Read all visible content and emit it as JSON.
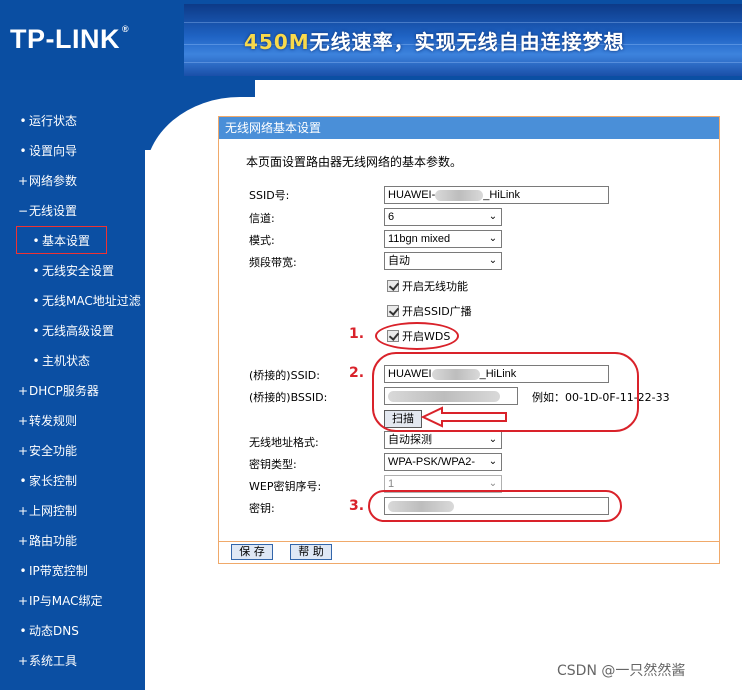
{
  "header": {
    "logo": "TP-LINK",
    "logo_mark": "®",
    "slogan_highlight": "450M",
    "slogan_rest": "无线速率，实现无线自由连接梦想"
  },
  "sidebar": {
    "items": [
      {
        "bullet": "•",
        "label": "运行状态"
      },
      {
        "bullet": "•",
        "label": "设置向导"
      },
      {
        "bullet": "+",
        "label": "网络参数"
      },
      {
        "bullet": "−",
        "label": "无线设置"
      },
      {
        "bullet": "•",
        "label": "基本设置",
        "active": true
      },
      {
        "bullet": "•",
        "label": "无线安全设置"
      },
      {
        "bullet": "•",
        "label": "无线MAC地址过滤"
      },
      {
        "bullet": "•",
        "label": "无线高级设置"
      },
      {
        "bullet": "•",
        "label": "主机状态"
      },
      {
        "bullet": "+",
        "label": "DHCP服务器"
      },
      {
        "bullet": "+",
        "label": "转发规则"
      },
      {
        "bullet": "+",
        "label": "安全功能"
      },
      {
        "bullet": "•",
        "label": "家长控制"
      },
      {
        "bullet": "+",
        "label": "上网控制"
      },
      {
        "bullet": "+",
        "label": "路由功能"
      },
      {
        "bullet": "•",
        "label": "IP带宽控制"
      },
      {
        "bullet": "+",
        "label": "IP与MAC绑定"
      },
      {
        "bullet": "•",
        "label": "动态DNS"
      },
      {
        "bullet": "+",
        "label": "系统工具"
      }
    ]
  },
  "panel": {
    "title": "无线网络基本设置",
    "description": "本页面设置路由器无线网络的基本参数。",
    "ssid_label": "SSID号:",
    "ssid_prefix": "HUAWEI-",
    "ssid_suffix": "_HiLink",
    "channel_label": "信道:",
    "channel_value": "6",
    "mode_label": "模式:",
    "mode_value": "11bgn mixed",
    "bandwidth_label": "频段带宽:",
    "bandwidth_value": "自动",
    "enable_wireless": "开启无线功能",
    "enable_ssid_broadcast": "开启SSID广播",
    "enable_wds": "开启WDS",
    "bridge_ssid_label": "(桥接的)SSID:",
    "bridge_ssid_prefix": "HUAWEI",
    "bridge_ssid_suffix": "_HiLink",
    "bridge_bssid_label": "(桥接的)BSSID:",
    "bssid_example": "例如：00-1D-0F-11-22-33",
    "scan_button": "扫描",
    "address_format_label": "无线地址格式:",
    "address_format_value": "自动探测",
    "key_type_label": "密钥类型:",
    "key_type_value": "WPA-PSK/WPA2-",
    "wep_index_label": "WEP密钥序号:",
    "wep_index_value": "1",
    "key_label": "密钥:",
    "save_button": "保 存",
    "help_button": "帮 助"
  },
  "annotations": {
    "n1": "1.",
    "n2": "2.",
    "n3": "3."
  },
  "watermark": "CSDN @一只然然酱",
  "colors": {
    "brand_blue": "#0b4fa3",
    "panel_title": "#4a8fd8",
    "panel_border": "#f0a96a",
    "annotation_red": "#d9222a"
  }
}
